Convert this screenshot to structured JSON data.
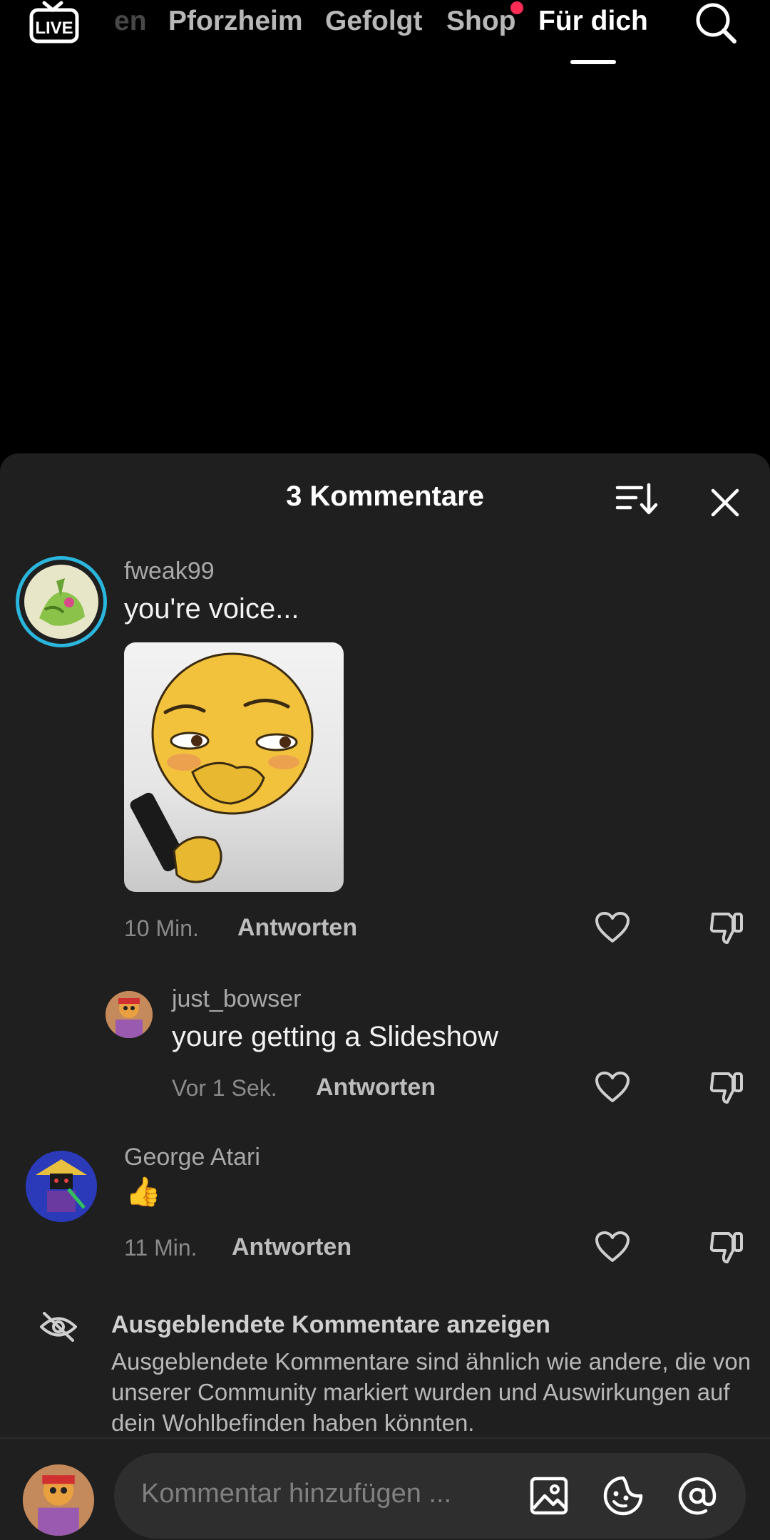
{
  "topnav": {
    "tabs": [
      {
        "label": "en",
        "state": "faded"
      },
      {
        "label": "Pforzheim",
        "state": "normal"
      },
      {
        "label": "Gefolgt",
        "state": "normal"
      },
      {
        "label": "Shop",
        "state": "normal",
        "notification_dot": true
      },
      {
        "label": "Für dich",
        "state": "active"
      }
    ],
    "live_label": "LIVE",
    "icons": {
      "live": "live-tv-icon",
      "search": "search-icon"
    },
    "accent_color": "#fe2c55"
  },
  "comments_sheet": {
    "title": "3 Kommentare",
    "icons": {
      "sort": "sort-icon",
      "close": "close-icon"
    },
    "comments": [
      {
        "username": "fweak99",
        "text": "you're voice...",
        "has_sticker": true,
        "time": "10 Min.",
        "reply_label": "Antworten"
      },
      {
        "username": "just_bowser",
        "text": "youre getting a Slideshow",
        "time": "Vor 1 Sek.",
        "reply_label": "Antworten",
        "is_reply": true
      },
      {
        "username": "George Atari",
        "text": "👍",
        "time": "11 Min.",
        "reply_label": "Antworten"
      }
    ],
    "hidden_comments": {
      "title": "Ausgeblendete Kommentare anzeigen",
      "description": "Ausgeblendete Kommentare sind ähnlich wie andere, die von unserer Community markiert wurden und Auswirkungen auf dein Wohlbefinden haben könnten.",
      "icon": "eye-slash-icon"
    },
    "composer": {
      "placeholder": "Kommentar hinzufügen ...",
      "icons": [
        "image-icon",
        "sticker-icon",
        "mention-icon"
      ]
    }
  }
}
